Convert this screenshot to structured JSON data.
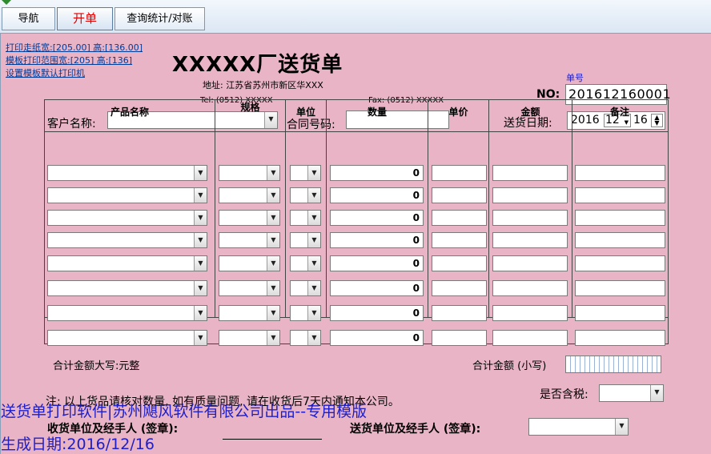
{
  "tabs": [
    {
      "label": "导航"
    },
    {
      "label": "开单"
    },
    {
      "label": "查询统计/对账"
    }
  ],
  "print_links": [
    "打印走纸宽:[205.00] 高:[136.00]",
    "模板打印范围宽:[205] 高:[136]",
    "设置模板默认打印机"
  ],
  "header": {
    "title": "XXXXX厂送货单",
    "address": "地址: 江苏省苏州市新区华XXX",
    "tel": "Tel: (0512) XXXXX",
    "fax": "Fax: (0512) XXXXX"
  },
  "number": {
    "caption": "单号",
    "label": "NO:",
    "value": "201612160001"
  },
  "fields": {
    "customer_label": "客户名称:",
    "customer_value": "",
    "contract_label": "合同号码:",
    "contract_value": "",
    "date_label": "送货日期:",
    "date_year": "2016",
    "date_month": "12",
    "date_day": "16"
  },
  "table": {
    "columns": [
      "产品名称",
      "规格",
      "单位",
      "数量",
      "单价",
      "金额",
      "备注"
    ],
    "rows": [
      {
        "qty": "0"
      },
      {
        "qty": "0"
      },
      {
        "qty": "0"
      },
      {
        "qty": "0"
      },
      {
        "qty": "0"
      },
      {
        "qty": "0"
      },
      {
        "qty": "0"
      },
      {
        "qty": "0"
      }
    ],
    "total_caps_label": "合计金额大写:元整",
    "total_small_label": "合计金额 (小写)"
  },
  "footer": {
    "note": "注: 以上货品请核对数量, 如有质量问题, 请在收货后7天内通知本公司。",
    "tax_label": "是否含税:",
    "receiver_label": "收货单位及经手人 (签章):",
    "sender_label": "送货单位及经手人 (签章):"
  },
  "overlay": {
    "line1": "送货单打印软件|苏州飓风软件有限公司出品--专用模版",
    "line2": "生成日期:2016/12/16"
  }
}
